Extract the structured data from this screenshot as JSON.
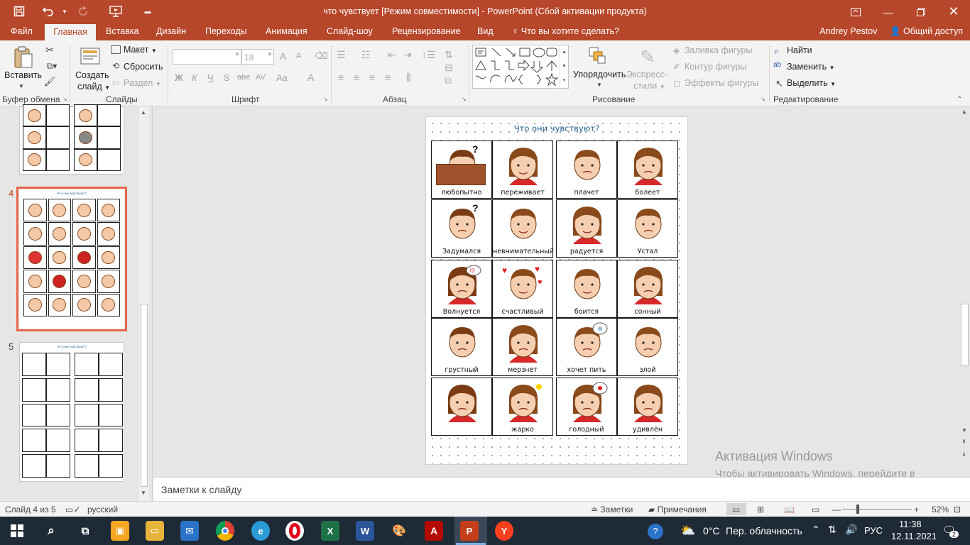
{
  "window": {
    "title": "что чувствует [Режим совместимости] - PowerPoint (Сбой активации продукта)"
  },
  "tabs": [
    "Файл",
    "Главная",
    "Вставка",
    "Дизайн",
    "Переходы",
    "Анимация",
    "Слайд-шоу",
    "Рецензирование",
    "Вид"
  ],
  "tell_me": "Что вы хотите сделать?",
  "user": "Andrey Pestov",
  "share": "Общий доступ",
  "ribbon": {
    "clipboard": {
      "paste": "Вставить",
      "label": "Буфер обмена"
    },
    "slides": {
      "new_slide_1": "Создать",
      "new_slide_2": "слайд",
      "layout": "Макет",
      "reset": "Сбросить",
      "section": "Раздел",
      "label": "Слайды"
    },
    "font": {
      "size": "18",
      "label": "Шрифт",
      "bold": "Ж",
      "italic": "К",
      "underline": "Ч",
      "shadow": "S",
      "strike": "abc",
      "spacing": "AV",
      "case": "Aa",
      "color": "A",
      "grow": "A",
      "shrink": "A"
    },
    "paragraph": {
      "label": "Абзац"
    },
    "drawing": {
      "arrange": "Упорядочить",
      "quick_styles_1": "Экспресс-",
      "quick_styles_2": "стили",
      "fill": "Заливка фигуры",
      "outline": "Контур фигуры",
      "effects": "Эффекты фигуры",
      "label": "Рисование"
    },
    "editing": {
      "find": "Найти",
      "replace": "Заменить",
      "select": "Выделить",
      "label": "Редактирование"
    }
  },
  "thumbnails": [
    {
      "number": "4",
      "title": "Что они чувствуют?"
    },
    {
      "number": "5",
      "title": "Что они чувствуют?"
    }
  ],
  "slide": {
    "title": "Что  они чувствуют?",
    "cards": [
      "любопытно",
      "переживает",
      "плачет",
      "болеет",
      "Задумался",
      "невнимательный",
      "радуется",
      "Устал",
      "Волнуется",
      "счастливый",
      "боится",
      "сонный",
      "грустный",
      "мерзнет",
      "хочет  пить",
      "злой",
      "",
      "жарко",
      "голодный",
      "удивлён"
    ]
  },
  "notes_placeholder": "Заметки к слайду",
  "activation": {
    "title": "Активация Windows",
    "text": "Чтобы активировать Windows, перейдите в раздел \"Параметры\"."
  },
  "status": {
    "slide_counter": "Слайд 4 из 5",
    "language": "русский",
    "notes": "Заметки",
    "comments": "Примечания",
    "zoom": "52%"
  },
  "taskbar": {
    "temperature": "0°C",
    "weather": "Пер. облачность",
    "lang": "РУС",
    "time": "11:38",
    "date": "12.11.2021",
    "notifications": "2"
  }
}
